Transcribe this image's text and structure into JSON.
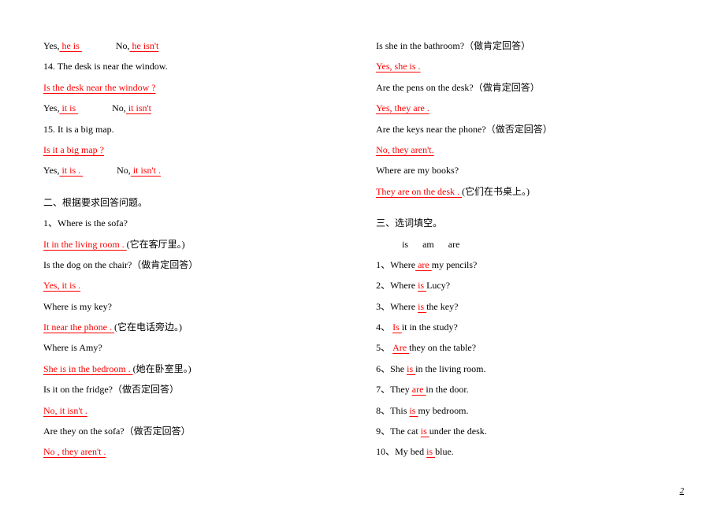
{
  "left": {
    "l1_pre": "Yes,",
    "l1_ans": " he is          ",
    "l1_mid": "No,",
    "l1_ans2": "  he isn't         ",
    "l2": "14. The desk is near the window. ",
    "l3": "  Is the desk near the window ?          ",
    "l4_pre": "Yes,",
    "l4_ans": "  it is         ",
    "l4_mid": "No,",
    "l4_ans2": "    it isn't        ",
    "l5": "15. It is a big map.",
    "l6": "Is it a big map ?           ",
    "l7_pre": "Yes,",
    "l7_ans": " it is .         ",
    "l7_mid": "No,",
    "l7_ans2": " it isn't .         ",
    "sec2_title": "二、根据要求回答问题。",
    "q1": "1、Where is the sofa?",
    "a1_pre": "      ",
    "a1": "It in the living room .                    ",
    "a1_note": "(它在客厅里。)",
    "q2": "Is the dog on the chair?（做肯定回答）",
    "a2_pre": "          ",
    "a2": "Yes, it is .               ",
    "q3": "Where is my key?",
    "a3_pre": "          ",
    "a3": "It near the phone .                     ",
    "a3_note": "(它在电话旁边。)",
    "q4": "Where is Amy?",
    "a4_pre": "               ",
    "a4": "She is in the bedroom .                 ",
    "a4_note": "(她在卧室里。)",
    "q5": "Is it on the fridge?（做否定回答）",
    "a5_pre": "               ",
    "a5": "No, it isn't .                 ",
    "q6": "Are they on the sofa?（做否定回答）",
    "a6_pre": "          ",
    "a6": "No , they aren't .                  "
  },
  "right": {
    "q7": "Is she in the bathroom?（做肯定回答）",
    "a7": " Yes, she is .                               ",
    "q8": "Are the pens on the desk?（做肯定回答）",
    "a8": "   Yes, they are .                            ",
    "q9": "Are the keys near the phone?（做否定回答）",
    "a9_pre": "          ",
    "a9": "No, they aren't.                         ",
    "q10": "Where are my books?",
    "a10": " They are on the desk .                         ",
    "a10_note": "(它们在书桌上。)",
    "sec3_title": "三、选词填空。",
    "options_pre": "          ",
    "opt_is": "is",
    "opt_am": "am",
    "opt_are": "are",
    "f1_pre": "1、Where",
    "f1_ans": "  are    ",
    "f1_post": "my pencils?",
    "f2_pre": "2、Where ",
    "f2_ans": "   is    ",
    "f2_post": " Lucy?",
    "f3_pre": "3、Where ",
    "f3_ans": "   is    ",
    "f3_post": " the key?",
    "f4_pre": "4、 ",
    "f4_ans": "    Is   ",
    "f4_post": " it in the study?",
    "f5_pre": "5、 ",
    "f5_ans": "   Are    ",
    "f5_post": " they on the table?",
    "f6_pre": "6、She  ",
    "f6_ans": "   is   ",
    "f6_post": " in the living room.",
    "f7_pre": "7、They ",
    "f7_ans": "   are    ",
    "f7_post": " in the door.",
    "f8_pre": "8、This ",
    "f8_ans": "   is    ",
    "f8_post": " my bedroom.",
    "f9_pre": "9、The cat ",
    "f9_ans": "   is     ",
    "f9_post": " under the desk.",
    "f10_pre": "10、My bed ",
    "f10_ans": "  is     ",
    "f10_post": " blue."
  },
  "page_num": "2"
}
